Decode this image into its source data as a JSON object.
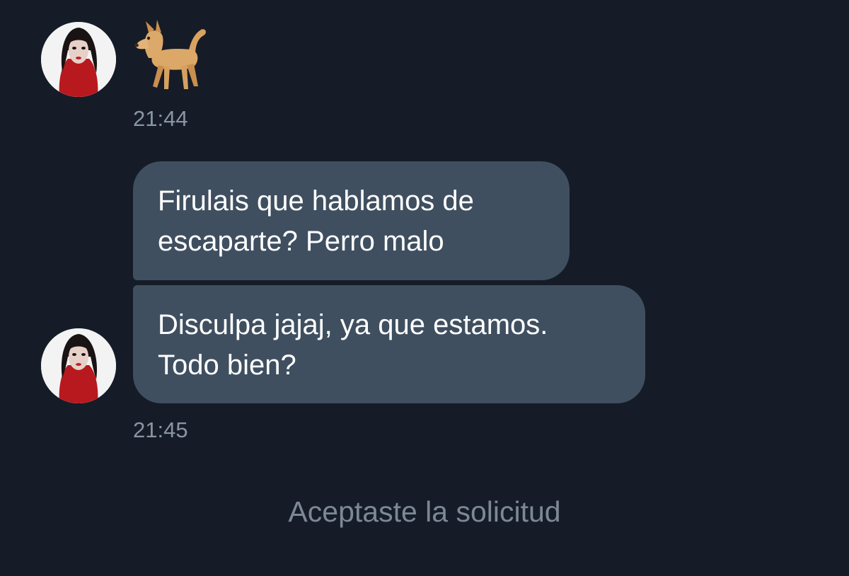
{
  "conversation": {
    "messages": [
      {
        "type": "emoji",
        "emoji": "dog-emoji",
        "time": "21:44"
      },
      {
        "type": "text",
        "lines": [
          "Firulais  que hablamos de",
          "escaparte? Perro malo"
        ]
      },
      {
        "type": "text",
        "lines": [
          "Disculpa jajaj, ya que estamos.",
          "Todo bien?"
        ],
        "time": "21:45"
      }
    ],
    "system_note": "Aceptaste la solicitud"
  },
  "colors": {
    "background": "#151c27",
    "bubble": "#3f4f60",
    "timestamp": "#8a95a3",
    "system_text": "#7d8896"
  }
}
